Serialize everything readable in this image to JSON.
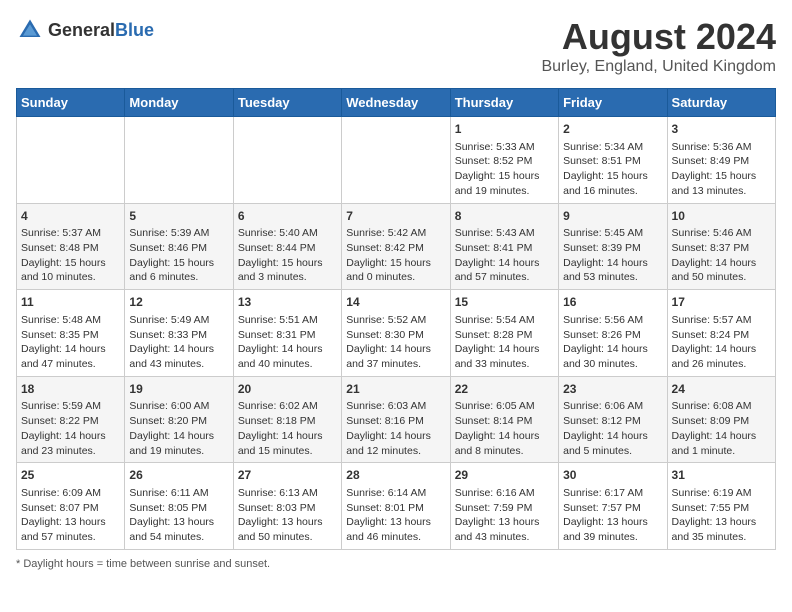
{
  "header": {
    "logo_general": "General",
    "logo_blue": "Blue",
    "main_title": "August 2024",
    "subtitle": "Burley, England, United Kingdom"
  },
  "days_of_week": [
    "Sunday",
    "Monday",
    "Tuesday",
    "Wednesday",
    "Thursday",
    "Friday",
    "Saturday"
  ],
  "footer": {
    "note": "Daylight hours"
  },
  "weeks": [
    [
      {
        "day": "",
        "info": ""
      },
      {
        "day": "",
        "info": ""
      },
      {
        "day": "",
        "info": ""
      },
      {
        "day": "",
        "info": ""
      },
      {
        "day": "1",
        "info": "Sunrise: 5:33 AM\nSunset: 8:52 PM\nDaylight: 15 hours\nand 19 minutes."
      },
      {
        "day": "2",
        "info": "Sunrise: 5:34 AM\nSunset: 8:51 PM\nDaylight: 15 hours\nand 16 minutes."
      },
      {
        "day": "3",
        "info": "Sunrise: 5:36 AM\nSunset: 8:49 PM\nDaylight: 15 hours\nand 13 minutes."
      }
    ],
    [
      {
        "day": "4",
        "info": "Sunrise: 5:37 AM\nSunset: 8:48 PM\nDaylight: 15 hours\nand 10 minutes."
      },
      {
        "day": "5",
        "info": "Sunrise: 5:39 AM\nSunset: 8:46 PM\nDaylight: 15 hours\nand 6 minutes."
      },
      {
        "day": "6",
        "info": "Sunrise: 5:40 AM\nSunset: 8:44 PM\nDaylight: 15 hours\nand 3 minutes."
      },
      {
        "day": "7",
        "info": "Sunrise: 5:42 AM\nSunset: 8:42 PM\nDaylight: 15 hours\nand 0 minutes."
      },
      {
        "day": "8",
        "info": "Sunrise: 5:43 AM\nSunset: 8:41 PM\nDaylight: 14 hours\nand 57 minutes."
      },
      {
        "day": "9",
        "info": "Sunrise: 5:45 AM\nSunset: 8:39 PM\nDaylight: 14 hours\nand 53 minutes."
      },
      {
        "day": "10",
        "info": "Sunrise: 5:46 AM\nSunset: 8:37 PM\nDaylight: 14 hours\nand 50 minutes."
      }
    ],
    [
      {
        "day": "11",
        "info": "Sunrise: 5:48 AM\nSunset: 8:35 PM\nDaylight: 14 hours\nand 47 minutes."
      },
      {
        "day": "12",
        "info": "Sunrise: 5:49 AM\nSunset: 8:33 PM\nDaylight: 14 hours\nand 43 minutes."
      },
      {
        "day": "13",
        "info": "Sunrise: 5:51 AM\nSunset: 8:31 PM\nDaylight: 14 hours\nand 40 minutes."
      },
      {
        "day": "14",
        "info": "Sunrise: 5:52 AM\nSunset: 8:30 PM\nDaylight: 14 hours\nand 37 minutes."
      },
      {
        "day": "15",
        "info": "Sunrise: 5:54 AM\nSunset: 8:28 PM\nDaylight: 14 hours\nand 33 minutes."
      },
      {
        "day": "16",
        "info": "Sunrise: 5:56 AM\nSunset: 8:26 PM\nDaylight: 14 hours\nand 30 minutes."
      },
      {
        "day": "17",
        "info": "Sunrise: 5:57 AM\nSunset: 8:24 PM\nDaylight: 14 hours\nand 26 minutes."
      }
    ],
    [
      {
        "day": "18",
        "info": "Sunrise: 5:59 AM\nSunset: 8:22 PM\nDaylight: 14 hours\nand 23 minutes."
      },
      {
        "day": "19",
        "info": "Sunrise: 6:00 AM\nSunset: 8:20 PM\nDaylight: 14 hours\nand 19 minutes."
      },
      {
        "day": "20",
        "info": "Sunrise: 6:02 AM\nSunset: 8:18 PM\nDaylight: 14 hours\nand 15 minutes."
      },
      {
        "day": "21",
        "info": "Sunrise: 6:03 AM\nSunset: 8:16 PM\nDaylight: 14 hours\nand 12 minutes."
      },
      {
        "day": "22",
        "info": "Sunrise: 6:05 AM\nSunset: 8:14 PM\nDaylight: 14 hours\nand 8 minutes."
      },
      {
        "day": "23",
        "info": "Sunrise: 6:06 AM\nSunset: 8:12 PM\nDaylight: 14 hours\nand 5 minutes."
      },
      {
        "day": "24",
        "info": "Sunrise: 6:08 AM\nSunset: 8:09 PM\nDaylight: 14 hours\nand 1 minute."
      }
    ],
    [
      {
        "day": "25",
        "info": "Sunrise: 6:09 AM\nSunset: 8:07 PM\nDaylight: 13 hours\nand 57 minutes."
      },
      {
        "day": "26",
        "info": "Sunrise: 6:11 AM\nSunset: 8:05 PM\nDaylight: 13 hours\nand 54 minutes."
      },
      {
        "day": "27",
        "info": "Sunrise: 6:13 AM\nSunset: 8:03 PM\nDaylight: 13 hours\nand 50 minutes."
      },
      {
        "day": "28",
        "info": "Sunrise: 6:14 AM\nSunset: 8:01 PM\nDaylight: 13 hours\nand 46 minutes."
      },
      {
        "day": "29",
        "info": "Sunrise: 6:16 AM\nSunset: 7:59 PM\nDaylight: 13 hours\nand 43 minutes."
      },
      {
        "day": "30",
        "info": "Sunrise: 6:17 AM\nSunset: 7:57 PM\nDaylight: 13 hours\nand 39 minutes."
      },
      {
        "day": "31",
        "info": "Sunrise: 6:19 AM\nSunset: 7:55 PM\nDaylight: 13 hours\nand 35 minutes."
      }
    ]
  ]
}
